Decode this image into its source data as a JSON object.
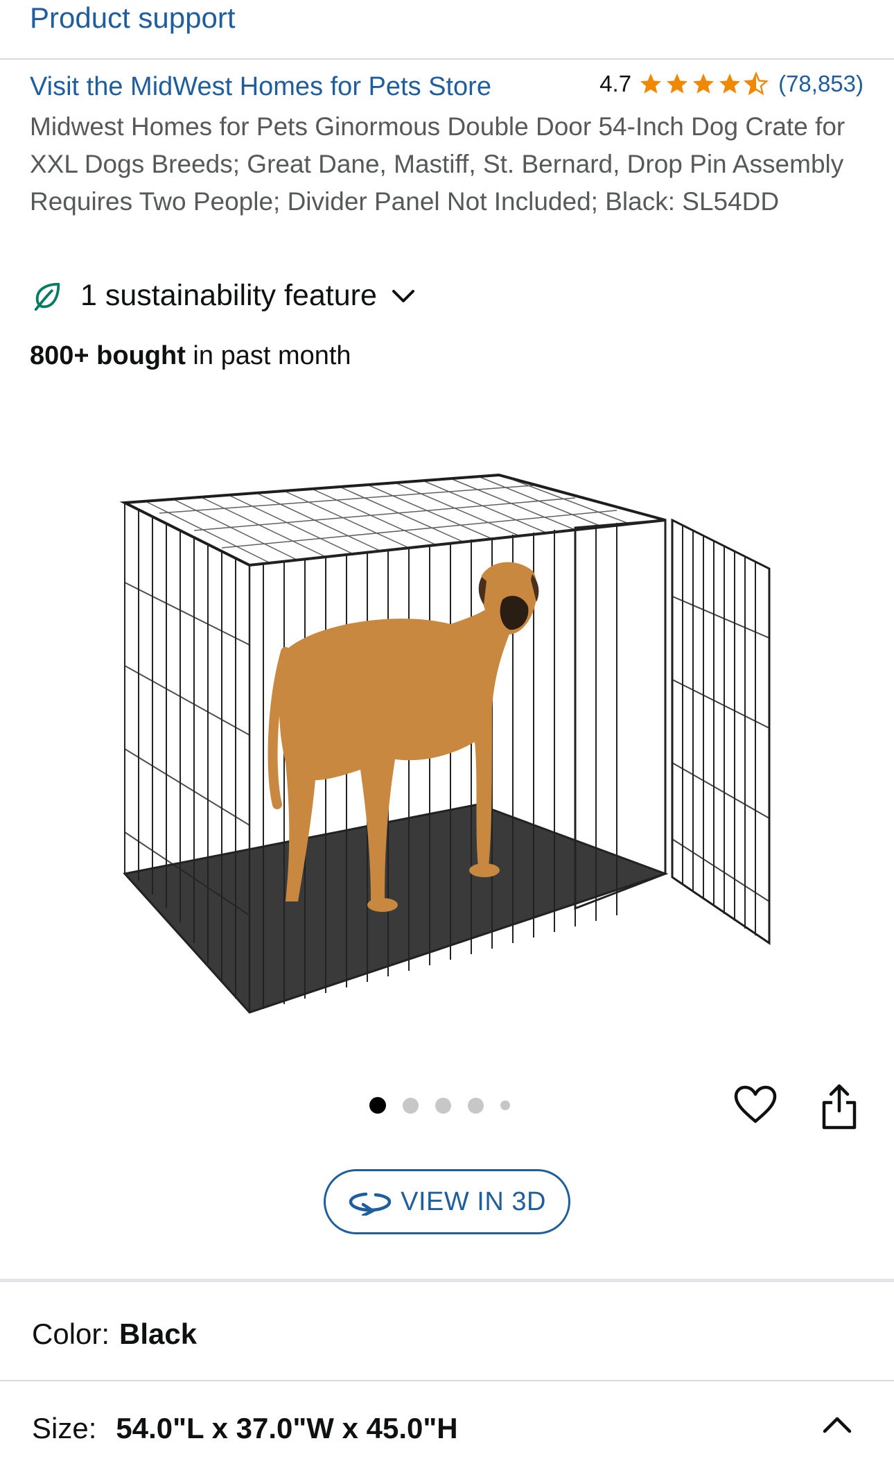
{
  "header": {
    "product_support": "Product support"
  },
  "store": {
    "link_text": "Visit the MidWest Homes for Pets Store"
  },
  "rating": {
    "value": "4.7",
    "stars": 4.7,
    "count": "(78,853)",
    "star_color": "#f08804"
  },
  "product": {
    "title": "Midwest Homes for Pets Ginormous Double Door 54-Inch Dog Crate for XXL Dogs Breeds; Great Dane, Mastiff, St. Bernard, Drop Pin Assembly Requires Two People; Divider Panel Not Included; Black: SL54DD"
  },
  "sustainability": {
    "label": "1 sustainability feature",
    "icon": "leaf-icon",
    "color": "#067d62"
  },
  "bought": {
    "bold": "800+ bought",
    "rest": " in past month"
  },
  "gallery": {
    "total_images": 5,
    "active_index": 0
  },
  "view3d": {
    "label": "VIEW IN 3D"
  },
  "color": {
    "label": "Color:",
    "value": "Black"
  },
  "size": {
    "label": "Size:",
    "value": "54.0\"L x 37.0\"W x 45.0\"H"
  },
  "colors": {
    "link": "#1f5e9e",
    "text": "#0f1111",
    "secondary": "#565959"
  }
}
